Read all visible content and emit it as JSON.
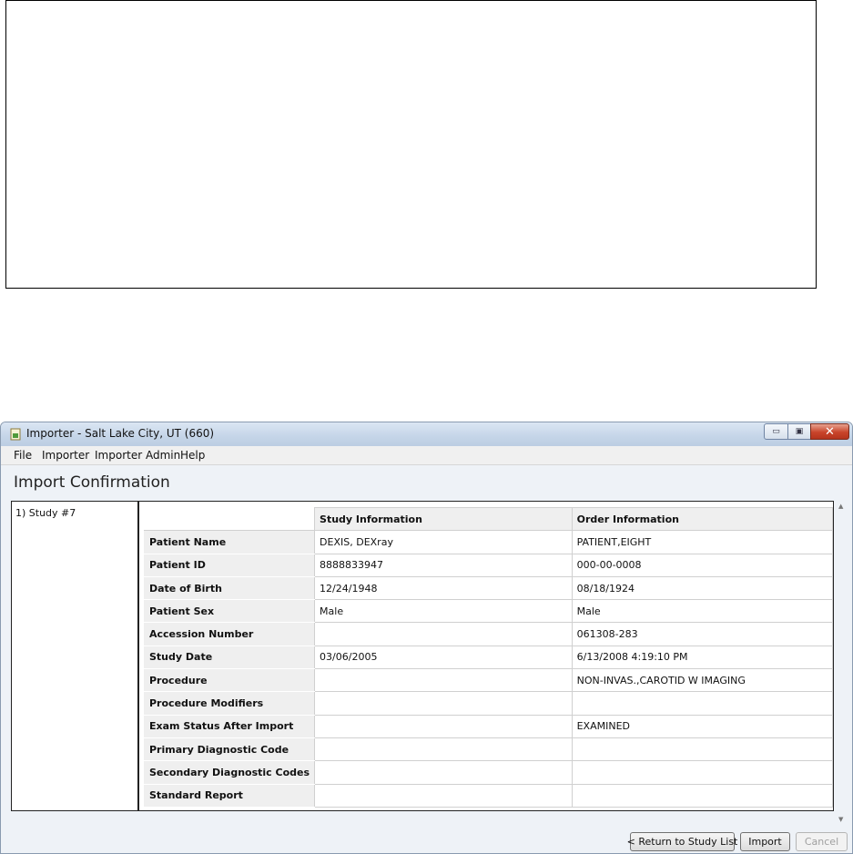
{
  "window": {
    "title": "Importer - Salt Lake City, UT (660)",
    "min_glyph": "▭",
    "max_glyph": "▣",
    "close_glyph": "✕"
  },
  "menu": [
    "File",
    "Importer",
    "Importer Admin",
    "Help"
  ],
  "page_title": "Import Confirmation",
  "study_list": [
    "1) Study #7"
  ],
  "table": {
    "headers": [
      "",
      "Study Information",
      "Order Information"
    ],
    "rows": [
      {
        "label": "Patient Name",
        "study": "DEXIS, DEXray",
        "order": "PATIENT,EIGHT"
      },
      {
        "label": "Patient ID",
        "study": "8888833947",
        "order": "000-00-0008"
      },
      {
        "label": "Date of Birth",
        "study": "12/24/1948",
        "order": "08/18/1924"
      },
      {
        "label": "Patient Sex",
        "study": "Male",
        "order": "Male"
      },
      {
        "label": "Accession Number",
        "study": "",
        "order": "061308-283"
      },
      {
        "label": "Study Date",
        "study": "03/06/2005",
        "order": "6/13/2008 4:19:10 PM"
      },
      {
        "label": "Procedure",
        "study": "",
        "order": "NON-INVAS.,CAROTID W IMAGING"
      },
      {
        "label": "Procedure Modifiers",
        "study": "",
        "order": ""
      },
      {
        "label": "Exam Status After Import",
        "study": "",
        "order": "EXAMINED"
      },
      {
        "label": "Primary Diagnostic Code",
        "study": "",
        "order": ""
      },
      {
        "label": "Secondary Diagnostic Codes",
        "study": "",
        "order": ""
      },
      {
        "label": "Standard Report",
        "study": "",
        "order": ""
      }
    ]
  },
  "buttons": {
    "return": "< Return to Study List",
    "import": "Import",
    "cancel": "Cancel"
  },
  "scroll": {
    "up": "▲",
    "down": "▼"
  }
}
